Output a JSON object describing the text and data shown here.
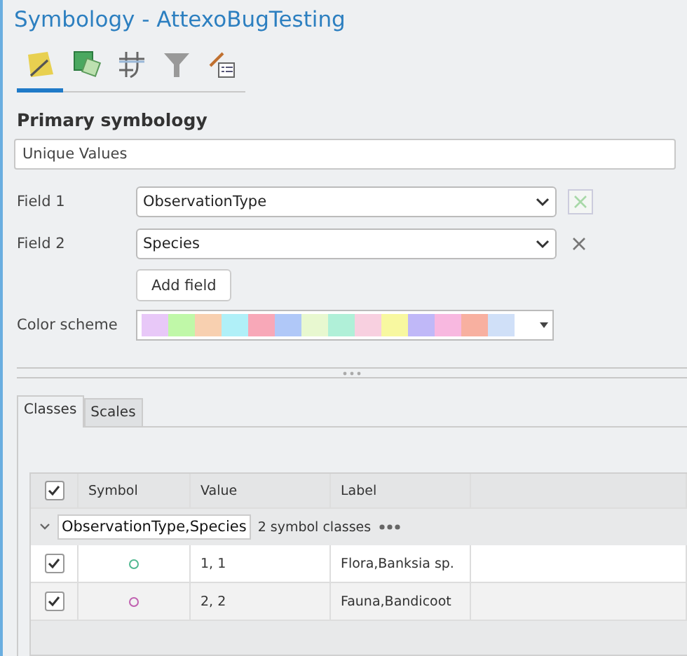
{
  "window": {
    "title": "Symbology - AttexoBugTesting"
  },
  "tool_tabs": [
    {
      "kind": "brush",
      "selected": true
    },
    {
      "kind": "layers",
      "selected": false
    },
    {
      "kind": "grid",
      "selected": false
    },
    {
      "kind": "filter",
      "selected": false
    },
    {
      "kind": "legend",
      "selected": false
    }
  ],
  "primary_symbology": {
    "label": "Primary symbology",
    "value": "Unique Values"
  },
  "fields": [
    {
      "label": "Field 1",
      "value": "ObservationType",
      "clear_disabled": true
    },
    {
      "label": "Field 2",
      "value": "Species",
      "clear_disabled": false
    }
  ],
  "add_field_button": "Add field",
  "color_scheme": {
    "label": "Color scheme",
    "swatches": [
      {
        "color": "#e8c8f8"
      },
      {
        "color": "#c0f8a8"
      },
      {
        "color": "#f8d0b0"
      },
      {
        "color": "#b0f0f8"
      },
      {
        "color": "#f8a8b8"
      },
      {
        "color": "#b0c8f8"
      },
      {
        "color": "#e8f8d0"
      },
      {
        "color": "#b0f0d8"
      },
      {
        "color": "#f8d0e0"
      },
      {
        "color": "#f8f8a0"
      },
      {
        "color": "#c0b8f8"
      },
      {
        "color": "#f8b8e0"
      },
      {
        "color": "#f8b0a0"
      },
      {
        "color": "#d0e0f8"
      }
    ]
  },
  "tabs": [
    {
      "label": "Classes",
      "selected": true
    },
    {
      "label": "Scales",
      "selected": false
    }
  ],
  "table": {
    "all_checked": true,
    "columns": [
      "Symbol",
      "Value",
      "Label"
    ],
    "group": {
      "expanded": true,
      "name": "ObservationType,Species",
      "count": "2 symbol classes"
    },
    "rows": [
      {
        "checked": true,
        "color": "#50b890",
        "value": "1, 1",
        "label": "Flora,Banksia sp."
      },
      {
        "checked": true,
        "color": "#c060b0",
        "value": "2, 2",
        "label": "Fauna,Bandicoot"
      }
    ]
  }
}
